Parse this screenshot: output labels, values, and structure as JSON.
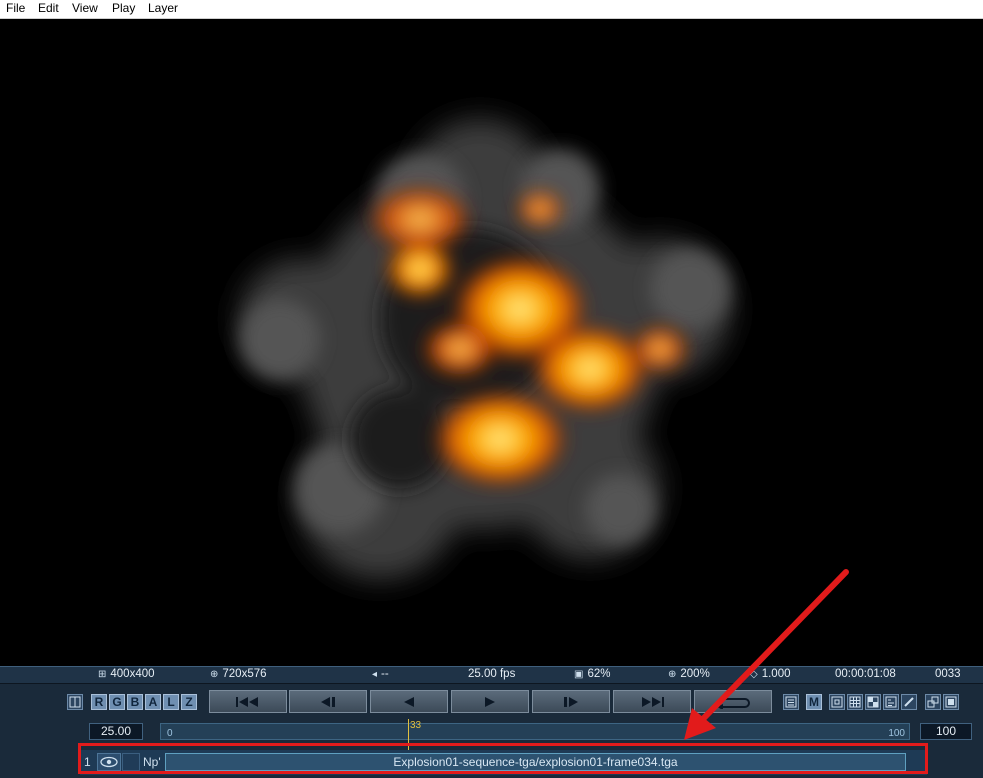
{
  "menu": [
    "File",
    "Edit",
    "View",
    "Play",
    "Layer"
  ],
  "info": {
    "image_size": "400x400",
    "output_size": "720x576",
    "audio": "--",
    "fps": "25.00 fps",
    "quality": "62%",
    "zoom": "200%",
    "ratio": "1.000",
    "timecode": "00:00:01:08",
    "frame": "0033"
  },
  "channels": [
    "R",
    "G",
    "B",
    "A",
    "L",
    "Z"
  ],
  "transport": [
    "first-frame",
    "step-back",
    "play-reverse",
    "play",
    "step-forward",
    "last-frame",
    "loop"
  ],
  "timeline": {
    "fps_field": "25.00",
    "start": "0",
    "end": "100",
    "current": "33",
    "end_field": "100",
    "current_fraction": 0.33
  },
  "layer": {
    "index": "1",
    "blend_mode": "Np'",
    "name": "Explosion01-sequence-tga/explosion01-frame034.tga"
  },
  "colors": {
    "panel": "#1a2a3a",
    "accent": "#6f8fb1",
    "annotation": "#e21b1b"
  }
}
